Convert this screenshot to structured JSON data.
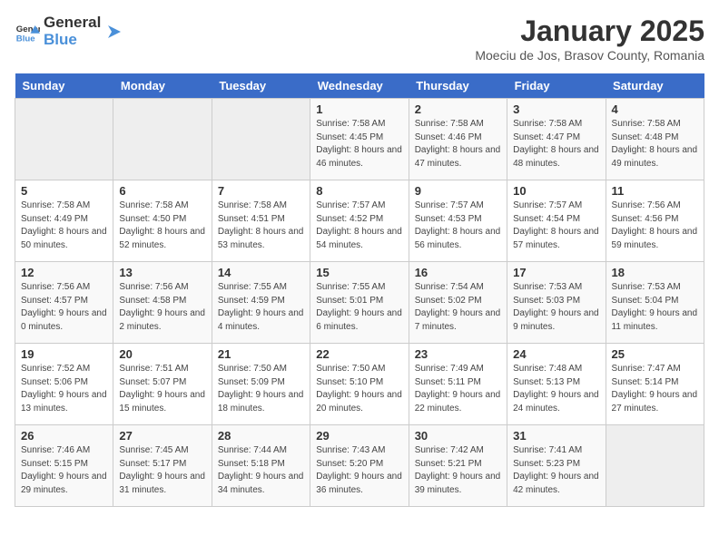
{
  "header": {
    "logo_general": "General",
    "logo_blue": "Blue",
    "month": "January 2025",
    "location": "Moeciu de Jos, Brasov County, Romania"
  },
  "weekdays": [
    "Sunday",
    "Monday",
    "Tuesday",
    "Wednesday",
    "Thursday",
    "Friday",
    "Saturday"
  ],
  "weeks": [
    [
      {
        "day": "",
        "sunrise": "",
        "sunset": "",
        "daylight": ""
      },
      {
        "day": "",
        "sunrise": "",
        "sunset": "",
        "daylight": ""
      },
      {
        "day": "",
        "sunrise": "",
        "sunset": "",
        "daylight": ""
      },
      {
        "day": "1",
        "sunrise": "Sunrise: 7:58 AM",
        "sunset": "Sunset: 4:45 PM",
        "daylight": "Daylight: 8 hours and 46 minutes."
      },
      {
        "day": "2",
        "sunrise": "Sunrise: 7:58 AM",
        "sunset": "Sunset: 4:46 PM",
        "daylight": "Daylight: 8 hours and 47 minutes."
      },
      {
        "day": "3",
        "sunrise": "Sunrise: 7:58 AM",
        "sunset": "Sunset: 4:47 PM",
        "daylight": "Daylight: 8 hours and 48 minutes."
      },
      {
        "day": "4",
        "sunrise": "Sunrise: 7:58 AM",
        "sunset": "Sunset: 4:48 PM",
        "daylight": "Daylight: 8 hours and 49 minutes."
      }
    ],
    [
      {
        "day": "5",
        "sunrise": "Sunrise: 7:58 AM",
        "sunset": "Sunset: 4:49 PM",
        "daylight": "Daylight: 8 hours and 50 minutes."
      },
      {
        "day": "6",
        "sunrise": "Sunrise: 7:58 AM",
        "sunset": "Sunset: 4:50 PM",
        "daylight": "Daylight: 8 hours and 52 minutes."
      },
      {
        "day": "7",
        "sunrise": "Sunrise: 7:58 AM",
        "sunset": "Sunset: 4:51 PM",
        "daylight": "Daylight: 8 hours and 53 minutes."
      },
      {
        "day": "8",
        "sunrise": "Sunrise: 7:57 AM",
        "sunset": "Sunset: 4:52 PM",
        "daylight": "Daylight: 8 hours and 54 minutes."
      },
      {
        "day": "9",
        "sunrise": "Sunrise: 7:57 AM",
        "sunset": "Sunset: 4:53 PM",
        "daylight": "Daylight: 8 hours and 56 minutes."
      },
      {
        "day": "10",
        "sunrise": "Sunrise: 7:57 AM",
        "sunset": "Sunset: 4:54 PM",
        "daylight": "Daylight: 8 hours and 57 minutes."
      },
      {
        "day": "11",
        "sunrise": "Sunrise: 7:56 AM",
        "sunset": "Sunset: 4:56 PM",
        "daylight": "Daylight: 8 hours and 59 minutes."
      }
    ],
    [
      {
        "day": "12",
        "sunrise": "Sunrise: 7:56 AM",
        "sunset": "Sunset: 4:57 PM",
        "daylight": "Daylight: 9 hours and 0 minutes."
      },
      {
        "day": "13",
        "sunrise": "Sunrise: 7:56 AM",
        "sunset": "Sunset: 4:58 PM",
        "daylight": "Daylight: 9 hours and 2 minutes."
      },
      {
        "day": "14",
        "sunrise": "Sunrise: 7:55 AM",
        "sunset": "Sunset: 4:59 PM",
        "daylight": "Daylight: 9 hours and 4 minutes."
      },
      {
        "day": "15",
        "sunrise": "Sunrise: 7:55 AM",
        "sunset": "Sunset: 5:01 PM",
        "daylight": "Daylight: 9 hours and 6 minutes."
      },
      {
        "day": "16",
        "sunrise": "Sunrise: 7:54 AM",
        "sunset": "Sunset: 5:02 PM",
        "daylight": "Daylight: 9 hours and 7 minutes."
      },
      {
        "day": "17",
        "sunrise": "Sunrise: 7:53 AM",
        "sunset": "Sunset: 5:03 PM",
        "daylight": "Daylight: 9 hours and 9 minutes."
      },
      {
        "day": "18",
        "sunrise": "Sunrise: 7:53 AM",
        "sunset": "Sunset: 5:04 PM",
        "daylight": "Daylight: 9 hours and 11 minutes."
      }
    ],
    [
      {
        "day": "19",
        "sunrise": "Sunrise: 7:52 AM",
        "sunset": "Sunset: 5:06 PM",
        "daylight": "Daylight: 9 hours and 13 minutes."
      },
      {
        "day": "20",
        "sunrise": "Sunrise: 7:51 AM",
        "sunset": "Sunset: 5:07 PM",
        "daylight": "Daylight: 9 hours and 15 minutes."
      },
      {
        "day": "21",
        "sunrise": "Sunrise: 7:50 AM",
        "sunset": "Sunset: 5:09 PM",
        "daylight": "Daylight: 9 hours and 18 minutes."
      },
      {
        "day": "22",
        "sunrise": "Sunrise: 7:50 AM",
        "sunset": "Sunset: 5:10 PM",
        "daylight": "Daylight: 9 hours and 20 minutes."
      },
      {
        "day": "23",
        "sunrise": "Sunrise: 7:49 AM",
        "sunset": "Sunset: 5:11 PM",
        "daylight": "Daylight: 9 hours and 22 minutes."
      },
      {
        "day": "24",
        "sunrise": "Sunrise: 7:48 AM",
        "sunset": "Sunset: 5:13 PM",
        "daylight": "Daylight: 9 hours and 24 minutes."
      },
      {
        "day": "25",
        "sunrise": "Sunrise: 7:47 AM",
        "sunset": "Sunset: 5:14 PM",
        "daylight": "Daylight: 9 hours and 27 minutes."
      }
    ],
    [
      {
        "day": "26",
        "sunrise": "Sunrise: 7:46 AM",
        "sunset": "Sunset: 5:15 PM",
        "daylight": "Daylight: 9 hours and 29 minutes."
      },
      {
        "day": "27",
        "sunrise": "Sunrise: 7:45 AM",
        "sunset": "Sunset: 5:17 PM",
        "daylight": "Daylight: 9 hours and 31 minutes."
      },
      {
        "day": "28",
        "sunrise": "Sunrise: 7:44 AM",
        "sunset": "Sunset: 5:18 PM",
        "daylight": "Daylight: 9 hours and 34 minutes."
      },
      {
        "day": "29",
        "sunrise": "Sunrise: 7:43 AM",
        "sunset": "Sunset: 5:20 PM",
        "daylight": "Daylight: 9 hours and 36 minutes."
      },
      {
        "day": "30",
        "sunrise": "Sunrise: 7:42 AM",
        "sunset": "Sunset: 5:21 PM",
        "daylight": "Daylight: 9 hours and 39 minutes."
      },
      {
        "day": "31",
        "sunrise": "Sunrise: 7:41 AM",
        "sunset": "Sunset: 5:23 PM",
        "daylight": "Daylight: 9 hours and 42 minutes."
      },
      {
        "day": "",
        "sunrise": "",
        "sunset": "",
        "daylight": ""
      }
    ]
  ]
}
